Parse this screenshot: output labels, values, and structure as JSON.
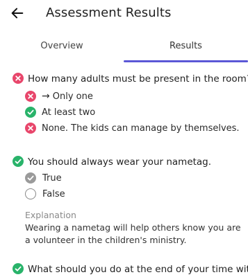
{
  "header": {
    "title": "Assessment Results",
    "back_icon": "arrow-left-icon"
  },
  "tabs": [
    {
      "label": "Overview",
      "selected": false
    },
    {
      "label": "Results",
      "selected": true
    }
  ],
  "colors": {
    "accent": "#5b57d6",
    "wrong": "#e8466b",
    "correct": "#29b36a"
  },
  "questions": [
    {
      "status": "wrong",
      "text": "How many adults must be present in the room?",
      "answers": [
        {
          "text": "Only one",
          "status": "wrong",
          "selected": true
        },
        {
          "text": "At least two",
          "status": "correct",
          "selected": false
        },
        {
          "text": "None. The kids can manage by themselves.",
          "status": "wrong",
          "selected": false
        }
      ]
    },
    {
      "status": "correct",
      "text": "You should always wear your nametag.",
      "answers": [
        {
          "text": "True",
          "selected": true
        },
        {
          "text": "False",
          "selected": false
        }
      ],
      "explanation_label": "Explanation",
      "explanation_text": "Wearing a nametag will help others know you are a volunteer in the children's ministry."
    },
    {
      "status": "correct",
      "text": "What should you do at the end of your time with"
    }
  ]
}
